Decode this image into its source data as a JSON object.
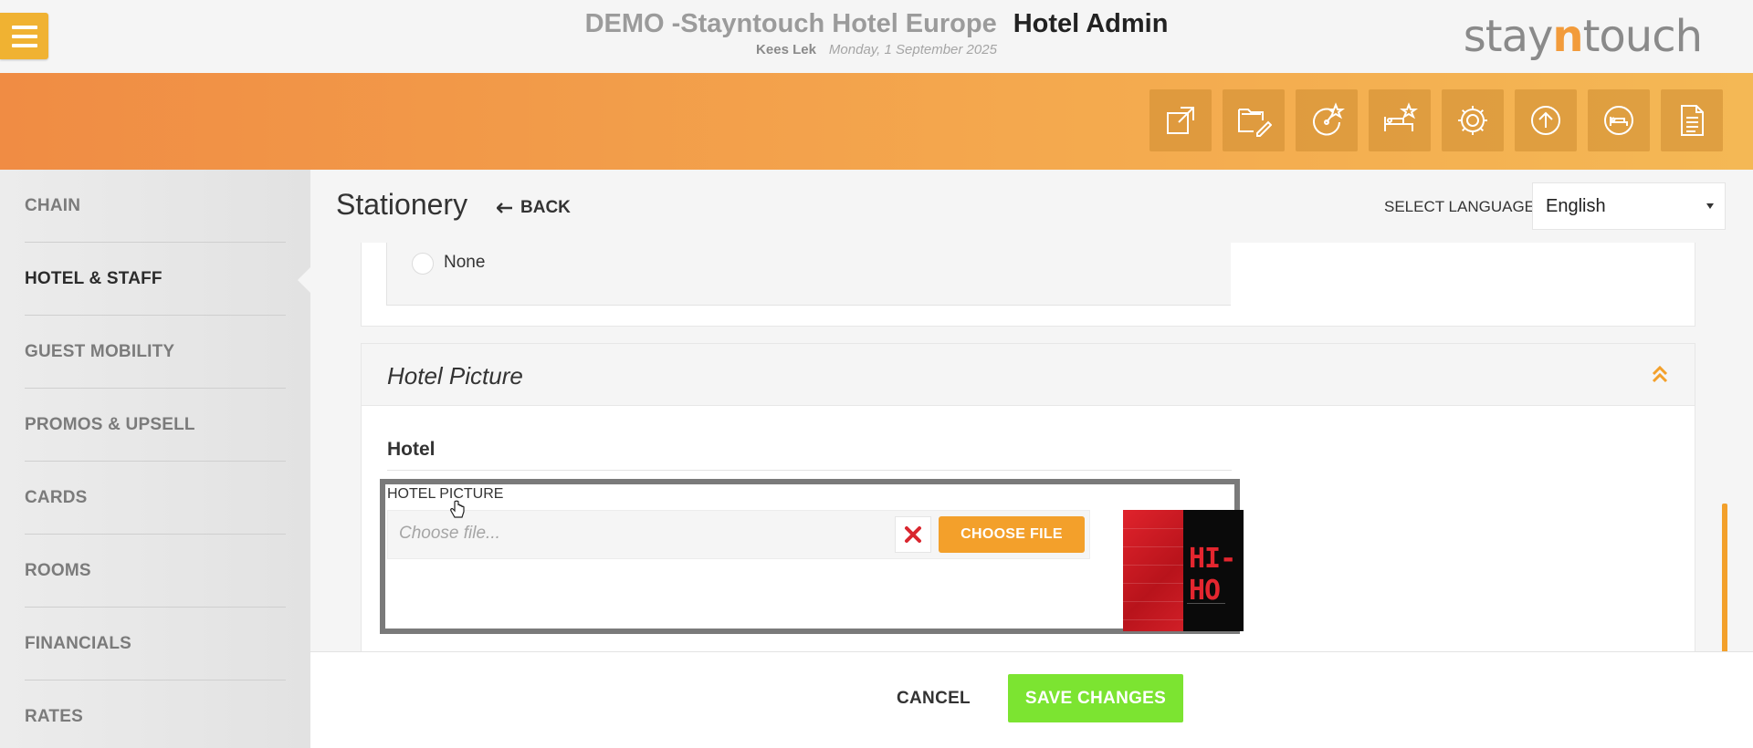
{
  "header": {
    "hotel_name": "DEMO -Stayntouch Hotel Europe",
    "app_name": "Hotel Admin",
    "user": "Kees Lek",
    "date": "Monday, 1 September 2025",
    "logo_prefix": "stay",
    "logo_accent": "n",
    "logo_suffix": "touch",
    "menu_icon": "hamburger-icon"
  },
  "toolbar": {
    "icons": [
      "external-link-icon",
      "folder-edit-icon",
      "dashboard-star-icon",
      "bed-star-icon",
      "settings-icon",
      "upload-icon",
      "bed-icon",
      "document-icon"
    ]
  },
  "sidebar": {
    "items": [
      {
        "label": "CHAIN",
        "active": false
      },
      {
        "label": "HOTEL & STAFF",
        "active": true
      },
      {
        "label": "GUEST MOBILITY",
        "active": false
      },
      {
        "label": "PROMOS & UPSELL",
        "active": false
      },
      {
        "label": "CARDS",
        "active": false
      },
      {
        "label": "ROOMS",
        "active": false
      },
      {
        "label": "FINANCIALS",
        "active": false
      },
      {
        "label": "RATES",
        "active": false
      }
    ]
  },
  "page": {
    "title": "Stationery",
    "back_label": "BACK",
    "language_label": "SELECT LANGUAGE",
    "language_value": "English"
  },
  "content": {
    "radio_option": "None",
    "picture_section": {
      "title": "Hotel Picture",
      "subsection": "Hotel",
      "field_label": "HOTEL PICTURE",
      "file_placeholder": "Choose file...",
      "choose_label": "CHOOSE FILE",
      "thumbnail_logo": "HI-HO"
    }
  },
  "footer": {
    "cancel_label": "CANCEL",
    "save_label": "SAVE CHANGES"
  },
  "colors": {
    "accent_orange": "#f3a02b",
    "save_green": "#7ce431",
    "band_start": "#f08c44",
    "band_end": "#f4b855"
  }
}
